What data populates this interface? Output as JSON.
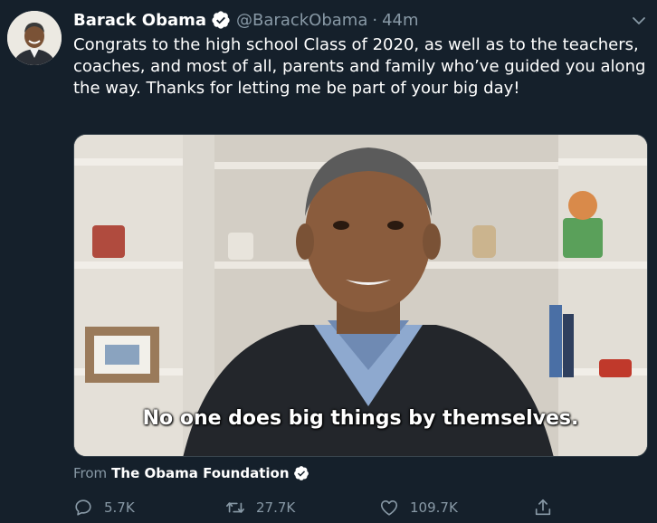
{
  "author": {
    "name": "Barack Obama",
    "handle": "@BarackObama",
    "separator": "·",
    "time": "44m"
  },
  "tweet": {
    "text": "Congrats to the high school Class of 2020, as well as to the teachers, coaches, and most of all, parents and family who’ve guided you along the way. Thanks for letting me be part of your big day!"
  },
  "media": {
    "subtitle": "No one does big things by themselves."
  },
  "source": {
    "prefix": "From",
    "name": "The Obama Foundation"
  },
  "actions": {
    "replies": "5.7K",
    "retweets": "27.7K",
    "likes": "109.7K"
  },
  "colors": {
    "background": "#15202b",
    "verified": "#ffffff",
    "secondary_text": "#8899a6"
  },
  "icons": [
    "verified-badge-icon",
    "chevron-down-icon",
    "reply-icon",
    "retweet-icon",
    "like-icon",
    "share-icon"
  ]
}
